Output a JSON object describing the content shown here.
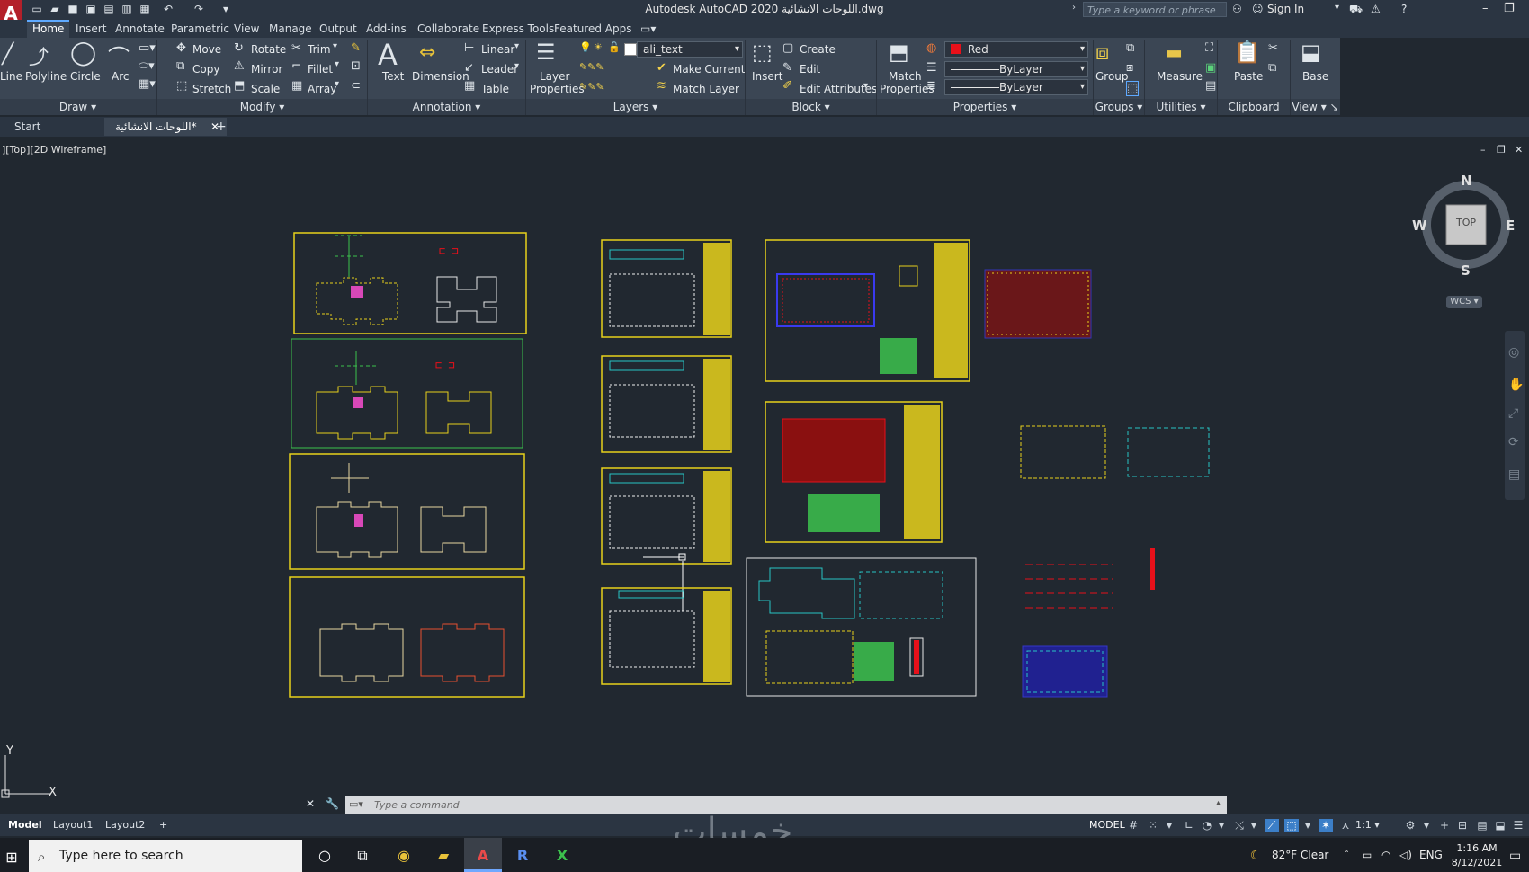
{
  "title_bar": {
    "app_logo": "A",
    "title": "Autodesk AutoCAD 2020   اللوحات الانشائية.dwg",
    "search_placeholder": "Type a keyword or phrase",
    "sign_in": "Sign In"
  },
  "ribbon_tabs": [
    "Home",
    "Insert",
    "Annotate",
    "Parametric",
    "View",
    "Manage",
    "Output",
    "Add-ins",
    "Collaborate",
    "Express Tools",
    "Featured Apps"
  ],
  "ribbon": {
    "draw": {
      "line": "Line",
      "polyline": "Polyline",
      "circle": "Circle",
      "arc": "Arc",
      "title": "Draw"
    },
    "modify": {
      "move": "Move",
      "rotate": "Rotate",
      "trim": "Trim",
      "copy": "Copy",
      "mirror": "Mirror",
      "fillet": "Fillet",
      "stretch": "Stretch",
      "scale": "Scale",
      "array": "Array",
      "title": "Modify"
    },
    "annotation": {
      "text": "Text",
      "dimension": "Dimension",
      "linear": "Linear",
      "leader": "Leader",
      "table": "Table",
      "title": "Annotation"
    },
    "layers": {
      "layer_properties_1": "Layer",
      "layer_properties_2": "Properties",
      "current_layer": "ali_text",
      "make_current": "Make Current",
      "match_layer": "Match Layer",
      "title": "Layers"
    },
    "block": {
      "insert": "Insert",
      "create": "Create",
      "edit": "Edit",
      "edit_attributes": "Edit Attributes",
      "title": "Block"
    },
    "properties": {
      "match_1": "Match",
      "match_2": "Properties",
      "color": "Red",
      "linetype": "ByLayer",
      "lineweight": "ByLayer",
      "title": "Properties"
    },
    "groups": {
      "group": "Group",
      "title": "Groups"
    },
    "utilities": {
      "measure": "Measure",
      "title": "Utilities"
    },
    "clipboard": {
      "paste": "Paste",
      "title": "Clipboard"
    },
    "view": {
      "base": "Base",
      "title": "View"
    }
  },
  "file_tabs": {
    "start": "Start",
    "drawing": "اللوحات الانشائية*"
  },
  "viewport": {
    "label": "][Top][2D Wireframe]",
    "viewcube": {
      "n": "N",
      "s": "S",
      "e": "E",
      "w": "W",
      "top": "TOP",
      "wcs": "WCS"
    },
    "ucs": {
      "y": "Y",
      "x": "X"
    }
  },
  "drawing_area": {},
  "command_line": {
    "placeholder": "Type a command"
  },
  "layout_tabs": [
    "Model",
    "Layout1",
    "Layout2"
  ],
  "status_bar": {
    "model": "MODEL",
    "scale": "1:1"
  },
  "watermark": "خمسات",
  "taskbar": {
    "search_placeholder": "Type here to search",
    "weather": "82°F  Clear",
    "language": "ENG",
    "time": "1:16 AM",
    "date": "8/12/2021"
  },
  "colors": {
    "accent_red": "#e8101a",
    "autocad_red": "#b3202a",
    "sheet_yellow": "#e7d11b",
    "sheet_green": "#44b544"
  }
}
